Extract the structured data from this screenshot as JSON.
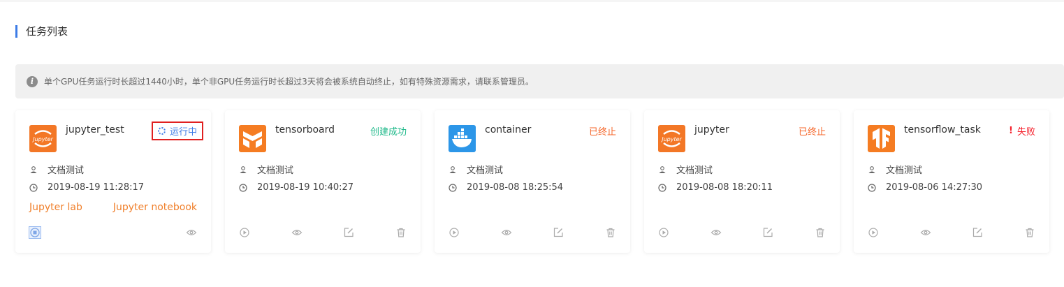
{
  "section": {
    "title": "任务列表"
  },
  "notice": {
    "text": "单个GPU任务运行时长超过1440小时，单个非GPU任务运行时长超过3天将会被系统自动终止，如有特殊资源需求，请联系管理员。",
    "icon": "info-icon"
  },
  "colors": {
    "accent": "#3d7ce6",
    "running": "#3d7ce6",
    "success": "#1fb98a",
    "stopped": "#f5662a",
    "failed": "#f5222d",
    "link": "#f07f2a"
  },
  "cards": [
    {
      "name": "jupyter_test",
      "logo": "jupyter-logo",
      "logo_text": "Jupyter",
      "status": "运行中",
      "owner": "文档测试",
      "time": "2019-08-19 11:28:17",
      "links": [
        "Jupyter lab",
        "Jupyter notebook"
      ]
    },
    {
      "name": "tensorboard",
      "logo": "tensorboard-logo",
      "status": "创建成功",
      "owner": "文档测试",
      "time": "2019-08-19 10:40:27"
    },
    {
      "name": "container",
      "logo": "docker-logo",
      "status": "已终止",
      "owner": "文档测试",
      "time": "2019-08-08 18:25:54"
    },
    {
      "name": "jupyter",
      "logo": "jupyter-logo",
      "logo_text": "Jupyter",
      "status": "已终止",
      "owner": "文档测试",
      "time": "2019-08-08 18:20:11"
    },
    {
      "name": "tensorflow_task",
      "logo": "tensorflow-logo",
      "status": "失败",
      "status_mark": "!",
      "owner": "文档测试",
      "time": "2019-08-06 14:27:30"
    }
  ]
}
